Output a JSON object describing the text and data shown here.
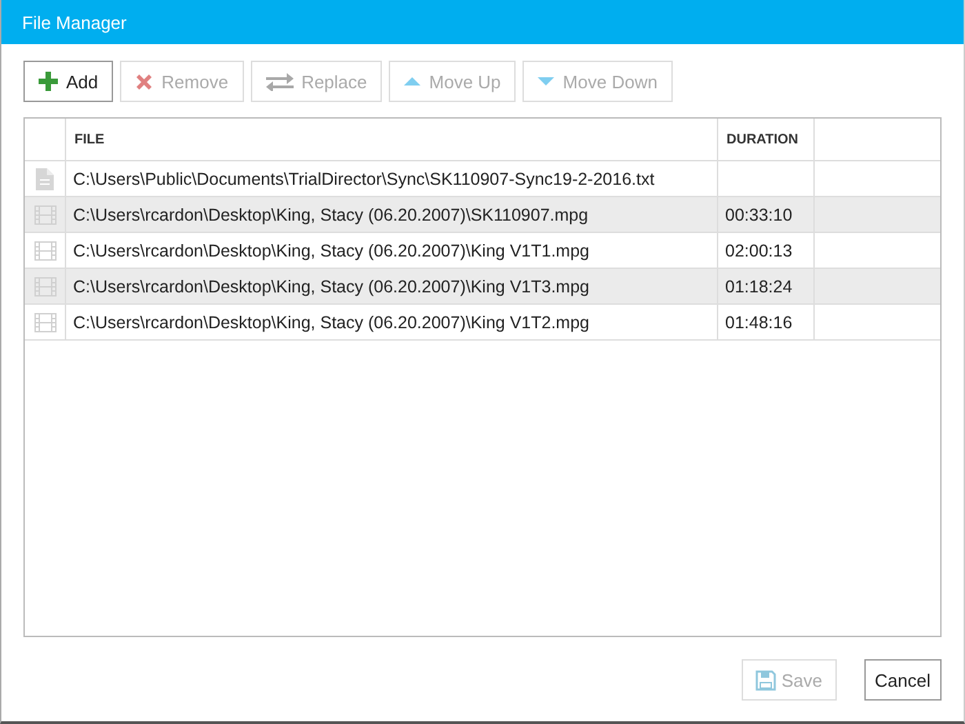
{
  "window": {
    "title": "File Manager"
  },
  "toolbar": [
    {
      "kind": "add",
      "label": "Add",
      "disabled": false
    },
    {
      "kind": "remove",
      "label": "Remove",
      "disabled": true
    },
    {
      "kind": "replace",
      "label": "Replace",
      "disabled": true
    },
    {
      "kind": "up",
      "label": "Move Up",
      "disabled": true
    },
    {
      "kind": "down",
      "label": "Move Down",
      "disabled": true
    }
  ],
  "table": {
    "columns": [
      "FILE",
      "DURATION"
    ],
    "rows": [
      {
        "kind": "document",
        "file": "C:\\Users\\Public\\Documents\\TrialDirector\\Sync\\SK110907-Sync19-2-2016.txt"
      },
      {
        "kind": "video",
        "file": "C:\\Users\\rcardon\\Desktop\\King, Stacy (06.20.2007)\\SK110907.mpg",
        "duration": "00:33:10"
      },
      {
        "kind": "video",
        "file": "C:\\Users\\rcardon\\Desktop\\King, Stacy (06.20.2007)\\King V1T1.mpg",
        "duration": "02:00:13"
      },
      {
        "kind": "video",
        "file": "C:\\Users\\rcardon\\Desktop\\King, Stacy (06.20.2007)\\King V1T3.mpg",
        "duration": "01:18:24"
      },
      {
        "kind": "video",
        "file": "C:\\Users\\rcardon\\Desktop\\King, Stacy (06.20.2007)\\King V1T2.mpg",
        "duration": "01:48:16"
      }
    ]
  },
  "footer": [
    {
      "kind": "save",
      "label": "Save",
      "disabled": true
    },
    {
      "kind": "cancel",
      "label": "Cancel",
      "disabled": false
    }
  ]
}
